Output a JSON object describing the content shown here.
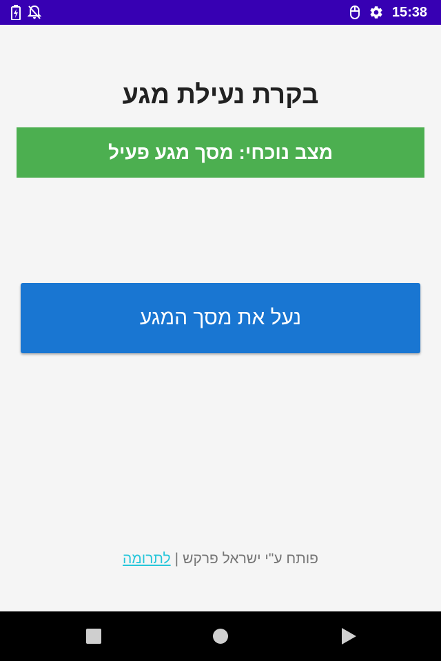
{
  "status_bar": {
    "time": "15:38",
    "left_icons": [
      "battery-charging-icon",
      "notifications-off-icon"
    ],
    "right_icons": [
      "mouse-icon",
      "settings-gear-icon"
    ],
    "background": "#3700b3"
  },
  "header": {
    "title": "בקרת נעילת מגע"
  },
  "status_banner": {
    "text": "מצב נוכחי: מסך מגע פעיל",
    "color": "#4caf50"
  },
  "main_action": {
    "label": "נעל את מסך המגע",
    "color": "#1976d2"
  },
  "footer": {
    "developer_text": "פותח ע\"י ישראל פרקש",
    "separator": "|",
    "donate_link": "לתרומה",
    "link_color": "#26c6da"
  },
  "nav_bar": {
    "buttons": [
      "recents-square-icon",
      "home-circle-icon",
      "back-triangle-icon"
    ]
  }
}
